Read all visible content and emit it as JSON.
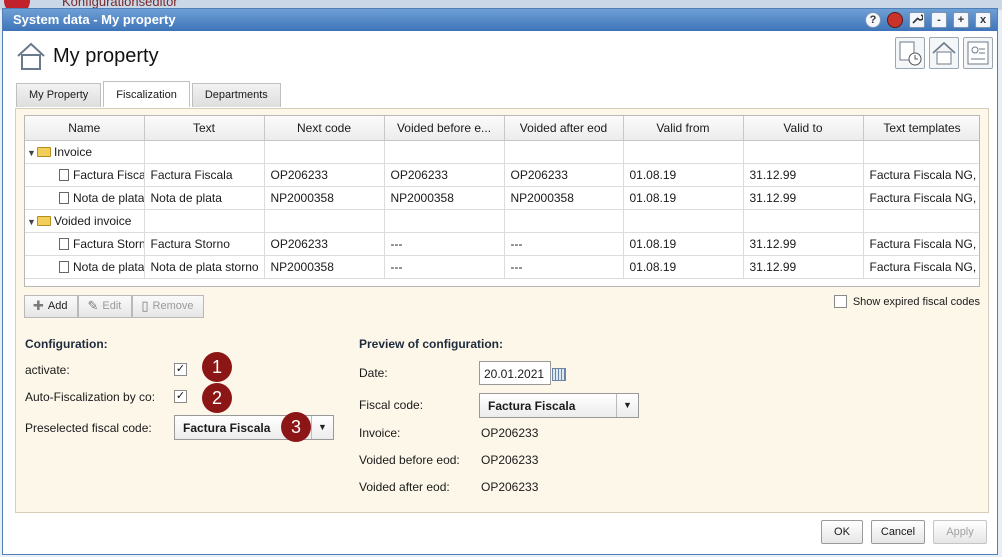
{
  "background_app": {
    "title": "Konfigurationseditor"
  },
  "window": {
    "title": "System data - My property",
    "controls": [
      "?",
      "",
      "",
      "-",
      "+",
      "x"
    ]
  },
  "page": {
    "title": "My property"
  },
  "tabs": [
    {
      "label": "My Property",
      "active": false
    },
    {
      "label": "Fiscalization",
      "active": true
    },
    {
      "label": "Departments",
      "active": false
    }
  ],
  "grid": {
    "columns": [
      "Name",
      "Text",
      "Next code",
      "Voided before e...",
      "Voided after eod",
      "Valid from",
      "Valid to",
      "Text templates"
    ],
    "groups": [
      {
        "name": "Invoice",
        "rows": [
          [
            "Factura Fiscala",
            "Factura Fiscala",
            "OP206233",
            "OP206233",
            "OP206233",
            "01.08.19",
            "31.12.99",
            "Factura Fiscala NG,"
          ],
          [
            "Nota de plata",
            "Nota de plata",
            "NP2000358",
            "NP2000358",
            "NP2000358",
            "01.08.19",
            "31.12.99",
            "Factura Fiscala NG,"
          ]
        ]
      },
      {
        "name": "Voided invoice",
        "rows": [
          [
            "Factura Storno",
            "Factura Storno",
            "OP206233",
            "---",
            "---",
            "01.08.19",
            "31.12.99",
            "Factura Fiscala NG,"
          ],
          [
            "Nota de plata storno",
            "Nota de plata storno",
            "NP2000358",
            "---",
            "---",
            "01.08.19",
            "31.12.99",
            "Factura Fiscala NG,"
          ]
        ]
      }
    ]
  },
  "actions": {
    "add": "Add",
    "edit": "Edit",
    "remove": "Remove"
  },
  "show_expired": {
    "label": "Show expired fiscal codes",
    "checked": false
  },
  "configuration": {
    "title": "Configuration:",
    "activate_label": "activate:",
    "activate_checked": true,
    "auto_label": "Auto-Fiscalization by co:",
    "auto_checked": true,
    "preselected_label": "Preselected fiscal code:",
    "preselected_value": "Factura Fiscala"
  },
  "badges": [
    "1",
    "2",
    "3"
  ],
  "preview": {
    "title": "Preview of configuration:",
    "date_label": "Date:",
    "date_value": "20.01.2021",
    "fiscal_code_label": "Fiscal code:",
    "fiscal_code_value": "Factura Fiscala",
    "invoice_label": "Invoice:",
    "invoice_value": "OP206233",
    "voided_before_label": "Voided before eod:",
    "voided_before_value": "OP206233",
    "voided_after_label": "Voided after eod:",
    "voided_after_value": "OP206233"
  },
  "footer": {
    "ok": "OK",
    "cancel": "Cancel",
    "apply": "Apply"
  },
  "colors": {
    "titlebar": "#3e74b8",
    "panel": "#fdf7ea",
    "badge": "#8c1616"
  }
}
